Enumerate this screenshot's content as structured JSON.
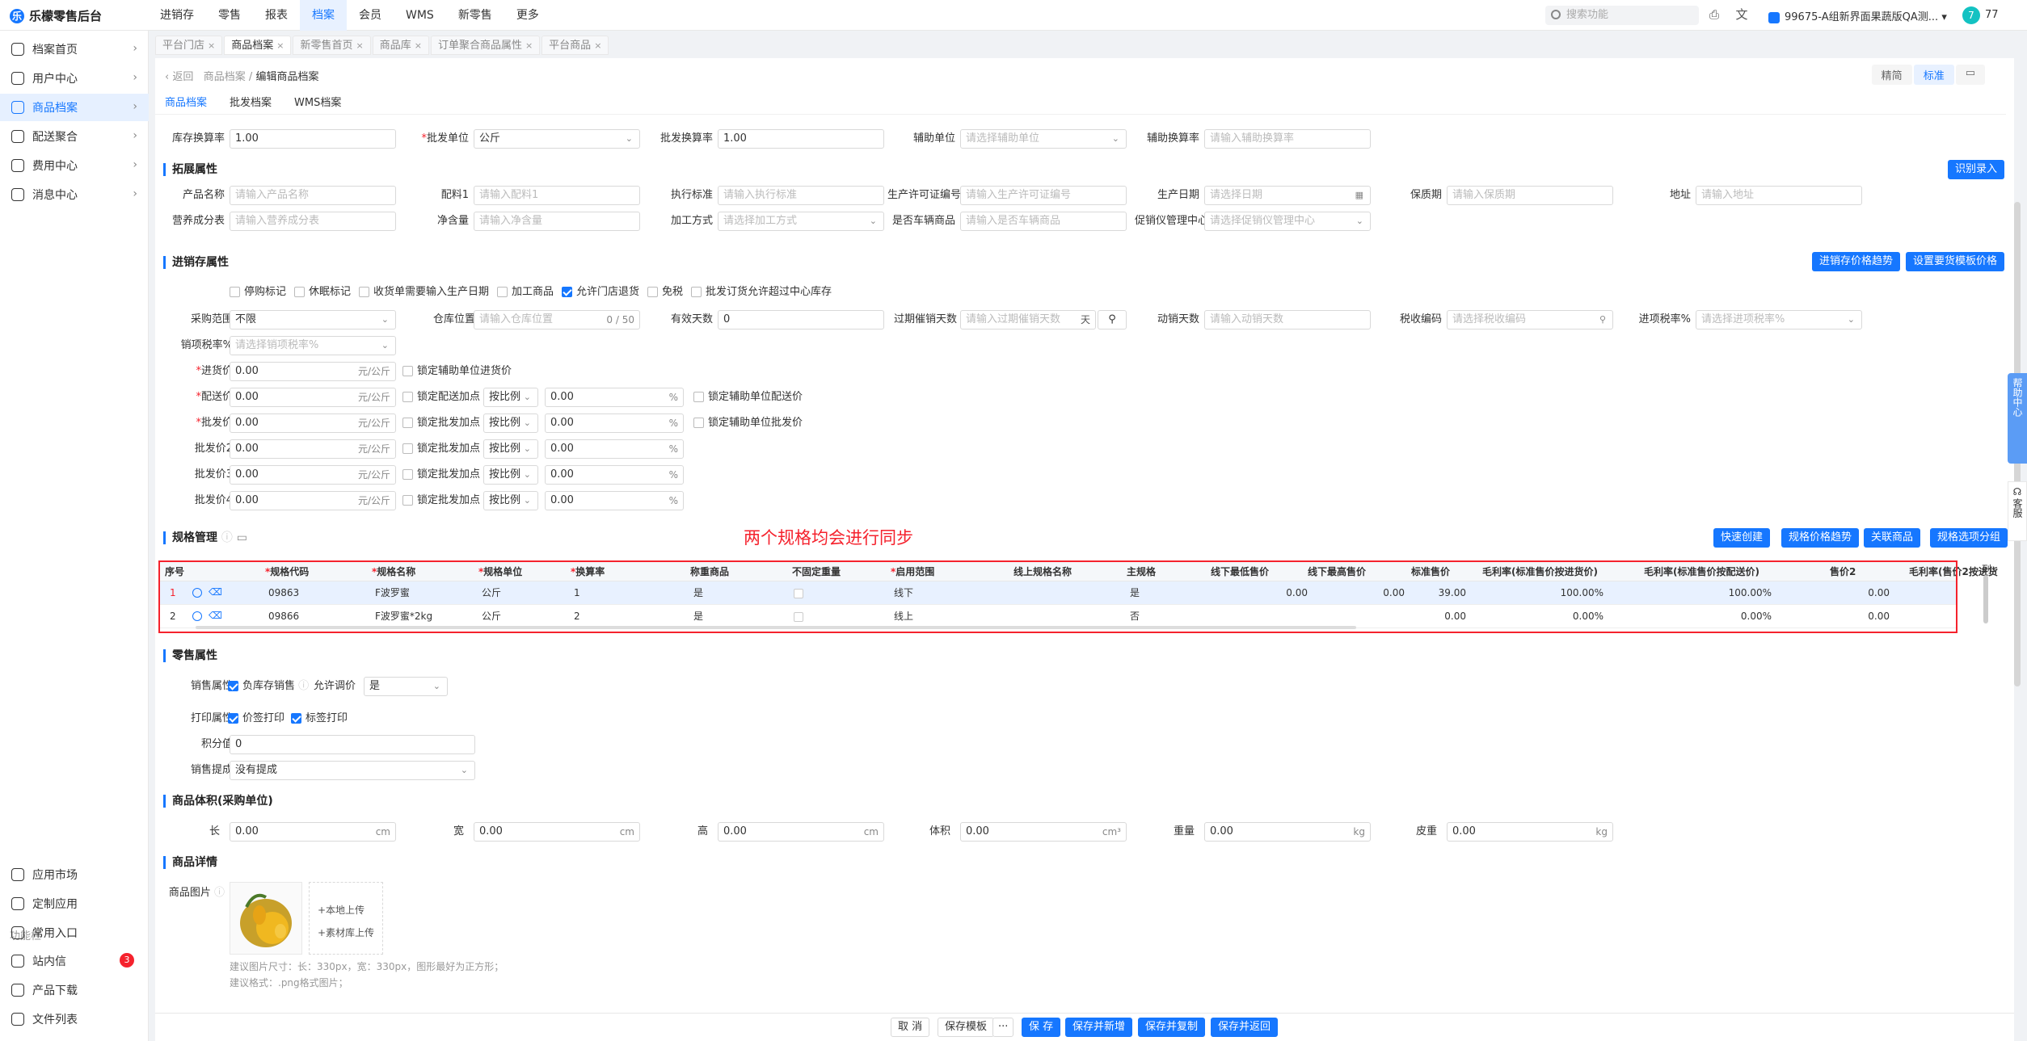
{
  "app": {
    "title": "乐檬零售后台",
    "logo_icon": "lemon-logo-icon"
  },
  "topnav": [
    "进销存",
    "零售",
    "报表",
    "档案",
    "会员",
    "WMS",
    "新零售",
    "更多"
  ],
  "topnav_active": "档案",
  "topbar": {
    "search_placeholder": "搜索功能",
    "store": "99675-A组新界面果蔬版QA测...",
    "avatar": "7",
    "user_num": "77"
  },
  "sidebar": {
    "items": [
      {
        "label": "档案首页"
      },
      {
        "label": "用户中心"
      },
      {
        "label": "商品档案"
      },
      {
        "label": "配送聚合"
      },
      {
        "label": "费用中心"
      },
      {
        "label": "消息中心"
      }
    ],
    "bottom": [
      {
        "label": "应用市场"
      },
      {
        "label": "定制应用"
      },
      {
        "label": "常用入口"
      }
    ],
    "section_label": "功能栏",
    "func": [
      {
        "label": "站内信",
        "badge": "3"
      },
      {
        "label": "产品下载"
      },
      {
        "label": "文件列表"
      }
    ]
  },
  "tabs": [
    "平台门店",
    "商品档案",
    "新零售首页",
    "商品库",
    "订单聚合商品属性",
    "平台商品"
  ],
  "breadcrumb": {
    "back": "返回",
    "parent": "商品档案",
    "sep": "/",
    "current": "编辑商品档案"
  },
  "view_toggle": [
    "精简",
    "标准"
  ],
  "subtabs": [
    "商品档案",
    "批发档案",
    "WMS档案"
  ],
  "top_row": {
    "kucun_label": "库存换算率",
    "kucun_value": "1.00",
    "pifa_unit_label": "批发单位",
    "pifa_unit_value": "公斤",
    "pifa_rate_label": "批发换算率",
    "pifa_rate_value": "1.00",
    "aux_unit_label": "辅助单位",
    "aux_unit_ph": "请选择辅助单位",
    "aux_rate_label": "辅助换算率",
    "aux_rate_ph": "请输入辅助换算率"
  },
  "ext": {
    "title": "拓展属性",
    "btn": "识别录入",
    "fields": [
      {
        "label": "产品名称",
        "ph": "请输入产品名称"
      },
      {
        "label": "配料1",
        "ph": "请输入配料1"
      },
      {
        "label": "执行标准",
        "ph": "请输入执行标准"
      },
      {
        "label": "生产许可证编号",
        "ph": "请输入生产许可证编号"
      },
      {
        "label": "生产日期",
        "ph": "请选择日期"
      },
      {
        "label": "保质期",
        "ph": "请输入保质期"
      },
      {
        "label": "地址",
        "ph": "请输入地址"
      },
      {
        "label": "营养成分表",
        "ph": "请输入营养成分表"
      },
      {
        "label": "净含量",
        "ph": "请输入净含量"
      },
      {
        "label": "加工方式",
        "ph": "请选择加工方式"
      },
      {
        "label": "是否车辆商品",
        "ph": "请输入是否车辆商品"
      },
      {
        "label": "促销仪管理中心",
        "ph": "请选择促销仪管理中心"
      }
    ]
  },
  "inv": {
    "title": "进销存属性",
    "btn1": "进销存价格趋势",
    "btn2": "设置要货模板价格",
    "checks": [
      {
        "label": "停购标记",
        "on": false
      },
      {
        "label": "休眠标记",
        "on": false
      },
      {
        "label": "收货单需要输入生产日期",
        "on": false
      },
      {
        "label": "加工商品",
        "on": false
      },
      {
        "label": "允许门店退货",
        "on": true
      },
      {
        "label": "免税",
        "on": false
      },
      {
        "label": "批发订货允许超过中心库存",
        "on": false
      }
    ],
    "purchase_range_label": "采购范围",
    "purchase_range_value": "不限",
    "warehouse_label": "仓库位置",
    "warehouse_ph": "请输入仓库位置",
    "warehouse_count": "0 / 50",
    "valid_days_label": "有效天数",
    "valid_days_value": "0",
    "expiry_label": "过期催销天数",
    "expiry_ph": "请输入过期催销天数",
    "expiry_unit": "天",
    "sales_days_label": "动销天数",
    "sales_days_ph": "请输入动销天数",
    "tax_code_label": "税收编码",
    "tax_code_ph": "请选择税收编码",
    "in_tax_label": "进项税率%",
    "in_tax_ph": "请选择进项税率%",
    "out_tax_label": "销项税率%",
    "out_tax_ph": "请选择销项税率%",
    "prices": [
      {
        "label": "进货价",
        "req": true,
        "value": "0.00",
        "unit": "元/公斤",
        "lock": "锁定辅助单位进货价",
        "mode": "",
        "pct": "",
        "lock2": ""
      },
      {
        "label": "配送价",
        "req": true,
        "value": "0.00",
        "unit": "元/公斤",
        "lock": "锁定配送加点",
        "mode": "按比例",
        "pct": "0.00",
        "lock2": "锁定辅助单位配送价"
      },
      {
        "label": "批发价",
        "req": true,
        "value": "0.00",
        "unit": "元/公斤",
        "lock": "锁定批发加点",
        "mode": "按比例",
        "pct": "0.00",
        "lock2": "锁定辅助单位批发价"
      },
      {
        "label": "批发价2",
        "req": false,
        "value": "0.00",
        "unit": "元/公斤",
        "lock": "锁定批发加点",
        "mode": "按比例",
        "pct": "0.00",
        "lock2": ""
      },
      {
        "label": "批发价3",
        "req": false,
        "value": "0.00",
        "unit": "元/公斤",
        "lock": "锁定批发加点",
        "mode": "按比例",
        "pct": "0.00",
        "lock2": ""
      },
      {
        "label": "批发价4",
        "req": false,
        "value": "0.00",
        "unit": "元/公斤",
        "lock": "锁定批发加点",
        "mode": "按比例",
        "pct": "0.00",
        "lock2": ""
      }
    ],
    "pct_unit": "%"
  },
  "spec": {
    "title": "规格管理",
    "annotation": "两个规格均会进行同步",
    "buttons": [
      "快速创建",
      "规格价格趋势",
      "关联商品",
      "规格选项分组"
    ],
    "columns": [
      "序号",
      "*规格代码",
      "*规格名称",
      "*规格单位",
      "*换算率",
      "称重商品",
      "不固定重量",
      "*启用范围",
      "线上规格名称",
      "主规格",
      "线下最低售价",
      "线下最高售价",
      "标准售价",
      "毛利率(标准售价按进货价)",
      "毛利率(标准售价按配送价)",
      "售价2",
      "毛利率(售价2按进货"
    ],
    "col_setting": "列",
    "rows": [
      {
        "no": "1",
        "code": "09863",
        "name": "F波罗蜜",
        "unit": "公斤",
        "rate": "1",
        "weigh": "是",
        "range": "线下",
        "main": "是",
        "min": "0.00",
        "max": "0.00",
        "std": "39.00",
        "m1": "100.00%",
        "m2": "100.00%",
        "p2": "0.00"
      },
      {
        "no": "2",
        "code": "09866",
        "name": "F波罗蜜*2kg",
        "unit": "公斤",
        "rate": "2",
        "weigh": "是",
        "range": "线上",
        "main": "否",
        "min": "",
        "max": "",
        "std": "0.00",
        "m1": "0.00%",
        "m2": "0.00%",
        "p2": "0.00"
      }
    ]
  },
  "retail": {
    "title": "零售属性",
    "sale_attr": "销售属性",
    "neg_stock": "负库存销售",
    "price_adj_label": "允许调价",
    "price_adj": "是",
    "print_attr": "打印属性",
    "price_tag": "价签打印",
    "label_print": "标签打印",
    "points_label": "积分值",
    "points": "0",
    "commission_label": "销售提成",
    "commission": "没有提成"
  },
  "volume": {
    "title": "商品体积(采购单位)",
    "fields": [
      {
        "label": "长",
        "value": "0.00",
        "unit": "cm"
      },
      {
        "label": "宽",
        "value": "0.00",
        "unit": "cm"
      },
      {
        "label": "高",
        "value": "0.00",
        "unit": "cm"
      },
      {
        "label": "体积",
        "value": "0.00",
        "unit": "cm³"
      },
      {
        "label": "重量",
        "value": "0.00",
        "unit": "kg"
      },
      {
        "label": "皮重",
        "value": "0.00",
        "unit": "kg"
      }
    ]
  },
  "detail": {
    "title": "商品详情",
    "img_label": "商品图片",
    "upload_local": "+本地上传",
    "upload_lib": "+素材库上传",
    "hint1": "建议图片尺寸：长：330px，宽：330px，图形最好为正方形；",
    "hint2": "建议格式：.png格式图片；"
  },
  "footer": [
    "取 消",
    "保存模板",
    "···",
    "保 存",
    "保存并新增",
    "保存并复制",
    "保存并返回"
  ],
  "rightbar": {
    "help": "帮助中心",
    "kefu": "客服"
  },
  "colors": {
    "primary": "#1677ff",
    "danger": "#f5222d"
  }
}
